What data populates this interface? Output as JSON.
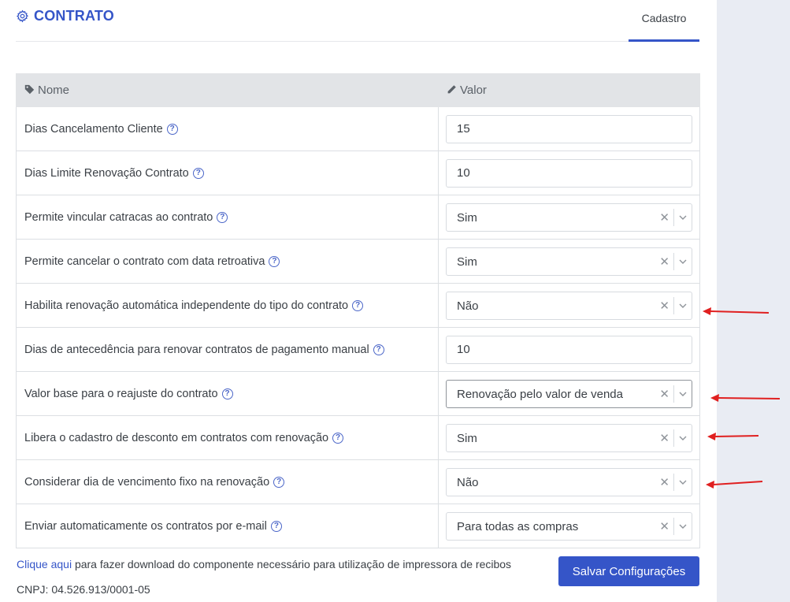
{
  "header": {
    "title": "CONTRATO",
    "tab_label": "Cadastro",
    "icon": "gear-icon"
  },
  "table": {
    "col_name": "Nome",
    "col_value": "Valor",
    "rows": [
      {
        "label": "Dias Cancelamento Cliente",
        "type": "input",
        "value": "15"
      },
      {
        "label": "Dias Limite Renovação Contrato",
        "type": "input",
        "value": "10"
      },
      {
        "label": "Permite vincular catracas ao contrato",
        "type": "select",
        "value": "Sim"
      },
      {
        "label": "Permite cancelar o contrato com data retroativa",
        "type": "select",
        "value": "Sim"
      },
      {
        "label": "Habilita renovação automática independente do tipo do contrato",
        "type": "select",
        "value": "Não"
      },
      {
        "label": "Dias de antecedência para renovar contratos de pagamento manual",
        "type": "input",
        "value": "10"
      },
      {
        "label": "Valor base para o reajuste do contrato",
        "type": "select",
        "value": "Renovação pelo valor de venda"
      },
      {
        "label": "Libera o cadastro de desconto em contratos com renovação",
        "type": "select",
        "value": "Sim"
      },
      {
        "label": "Considerar dia de vencimento fixo na renovação",
        "type": "select",
        "value": "Não"
      },
      {
        "label": "Enviar automaticamente os contratos por e-mail",
        "type": "select",
        "value": "Para todas as compras"
      }
    ]
  },
  "footer": {
    "link_text": "Clique aqui",
    "text": " para fazer download do componente necessário para utilização de impressora de recibos",
    "cnpj": "CNPJ: 04.526.913/0001-05",
    "save_label": "Salvar Configurações"
  },
  "colors": {
    "accent": "#3555c8",
    "annotation_arrow": "#e02020"
  }
}
